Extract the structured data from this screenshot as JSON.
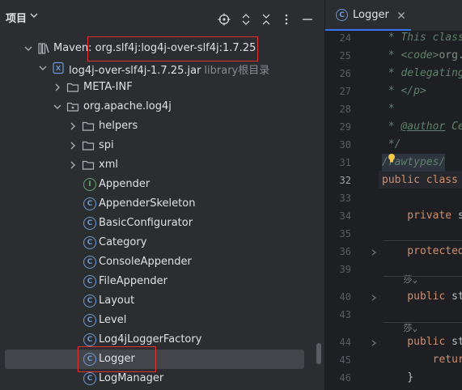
{
  "panel": {
    "title": "项目",
    "icons": [
      "locate-icon",
      "expand-all-icon",
      "collapse-all-icon",
      "options-icon",
      "hide-icon"
    ]
  },
  "tree": {
    "maven_prefix": "Maven: ",
    "maven_coord": "org.slf4j:log4j-over-slf4j:1.7.25",
    "jar_name": "log4j-over-slf4j-1.7.25.jar",
    "jar_hint": "library根目录",
    "meta_inf": "META-INF",
    "package": "org.apache.log4j",
    "folders": [
      "helpers",
      "spi",
      "xml"
    ],
    "classes": [
      {
        "name": "Appender",
        "kind": "interface"
      },
      {
        "name": "AppenderSkeleton",
        "kind": "class"
      },
      {
        "name": "BasicConfigurator",
        "kind": "class"
      },
      {
        "name": "Category",
        "kind": "class"
      },
      {
        "name": "ConsoleAppender",
        "kind": "class"
      },
      {
        "name": "FileAppender",
        "kind": "class"
      },
      {
        "name": "Layout",
        "kind": "class"
      },
      {
        "name": "Level",
        "kind": "class"
      },
      {
        "name": "Log4jLoggerFactory",
        "kind": "class"
      },
      {
        "name": "Logger",
        "kind": "class",
        "selected": true
      },
      {
        "name": "LogManager",
        "kind": "class"
      }
    ],
    "class_letter": "C",
    "interface_letter": "I"
  },
  "editor": {
    "tab_label": "Logger",
    "line_numbers": [
      "24",
      "25",
      "26",
      "27",
      "28",
      "29",
      "30",
      "31",
      "32",
      "33",
      "34",
      "35",
      "36",
      "39",
      "40",
      "43",
      "44",
      "45",
      "46"
    ],
    "current_line": "32",
    "code": {
      "l24": " * This class",
      "l25_a": " * <code>",
      "l25_b": "org.",
      "l26": " * delegating",
      "l27": " * </p>",
      "l28": " *",
      "l29_a": " * ",
      "l29_b": "@author",
      "l29_c": " Ce",
      "l30": " */",
      "l31": "/rawtypes/",
      "l32_a": "public class",
      "l34_a": "    private",
      "l34_b": " s",
      "l36_a": "    protected",
      "l40_a": "    public",
      "l40_b": " st",
      "l44_a": "    public",
      "l44_b": " st",
      "l45_a": "        retur",
      "l46": "    }",
      "hint1": "    莎⌄",
      "hint2": "    莎⌄"
    }
  }
}
